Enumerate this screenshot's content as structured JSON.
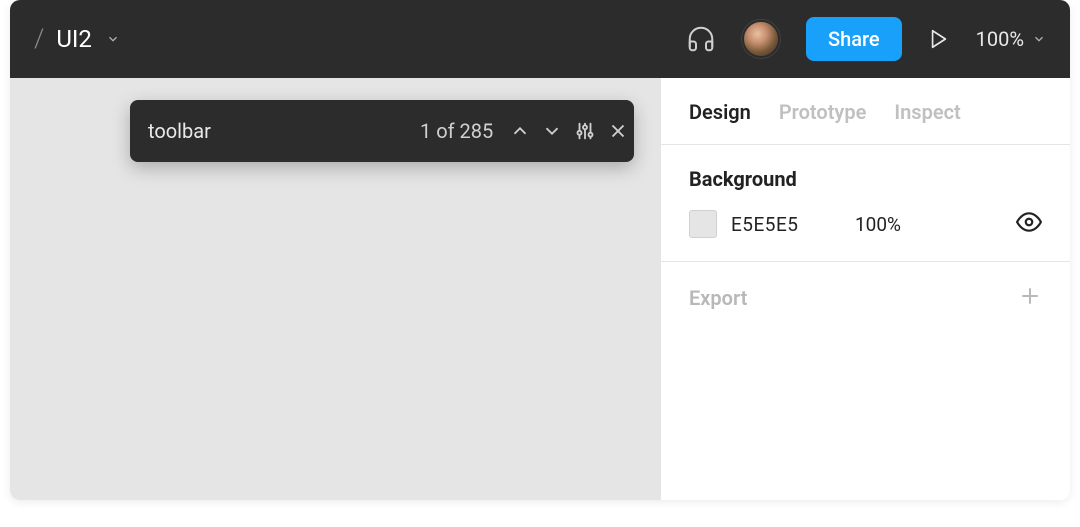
{
  "header": {
    "file_name": "UI2",
    "share_label": "Share",
    "zoom_label": "100%"
  },
  "search": {
    "value": "toolbar",
    "result_count_label": "1 of 285"
  },
  "panel": {
    "tabs": [
      {
        "label": "Design",
        "active": true
      },
      {
        "label": "Prototype",
        "active": false
      },
      {
        "label": "Inspect",
        "active": false
      }
    ],
    "background": {
      "section_title": "Background",
      "hex": "E5E5E5",
      "opacity": "100%"
    },
    "export": {
      "label": "Export"
    }
  }
}
